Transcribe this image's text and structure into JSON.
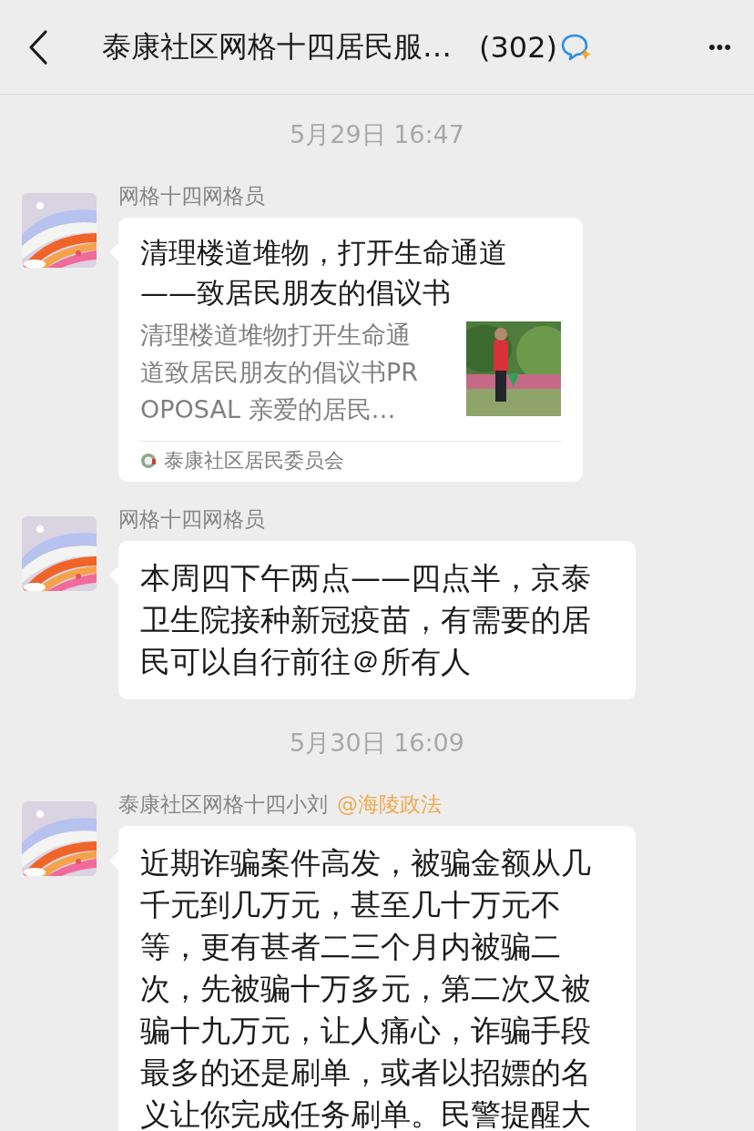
{
  "header": {
    "title": "泰康社区网格十四居民服…",
    "count": "(302)",
    "more": "•••"
  },
  "messages": [
    {
      "kind": "time",
      "text": "5月29日 16:47"
    },
    {
      "kind": "link",
      "sender": "网格十四网格员",
      "title": "清理楼道堆物，打开生命通道——致居民朋友的倡议书",
      "description": "清理楼道堆物打开生命通道致居民朋友的倡议书PROPOSAL 亲爱的居民…",
      "source": "泰康社区居民委员会"
    },
    {
      "kind": "text",
      "sender": "网格十四网格员",
      "text": "本周四下午两点——四点半，京泰卫生院接种新冠疫苗，有需要的居民可以自行前往＠所有人"
    },
    {
      "kind": "time",
      "text": "5月30日 16:09"
    },
    {
      "kind": "text",
      "sender": "泰康社区网格十四小刘",
      "mention": "@海陵政法",
      "text": "近期诈骗案件高发，被骗金额从几千元到几万元，甚至几十万元不等，更有甚者二三个月内被骗二次，先被骗十万多元，第二次又被骗十九万元，让人痛心，诈骗手段最多的还是刷单，或者以招嫖的名义让你完成任务刷单。民警提醒大"
    }
  ]
}
